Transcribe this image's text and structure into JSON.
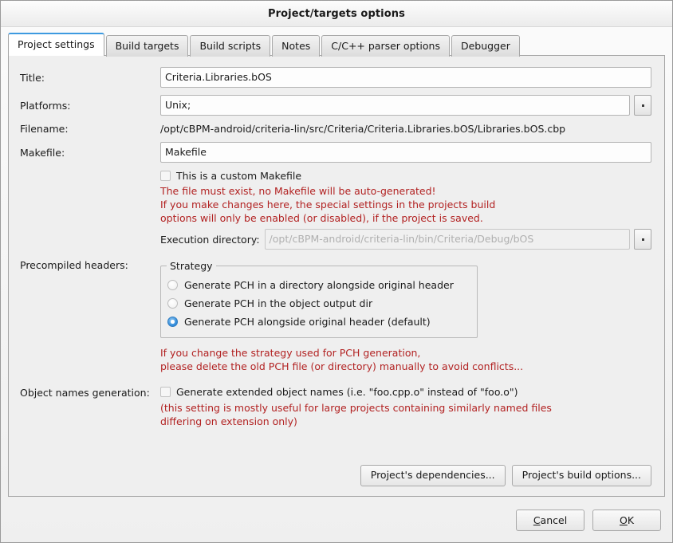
{
  "window": {
    "title": "Project/targets options"
  },
  "tabs": [
    {
      "label": "Project settings",
      "active": true
    },
    {
      "label": "Build targets",
      "active": false
    },
    {
      "label": "Build scripts",
      "active": false
    },
    {
      "label": "Notes",
      "active": false
    },
    {
      "label": "C/C++ parser options",
      "active": false
    },
    {
      "label": "Debugger",
      "active": false
    }
  ],
  "form": {
    "title_label": "Title:",
    "title_value": "Criteria.Libraries.bOS",
    "platforms_label": "Platforms:",
    "platforms_value": "Unix;",
    "platforms_browse": "browse-button",
    "filename_label": "Filename:",
    "filename_value": "/opt/cBPM-android/criteria-lin/src/Criteria/Criteria.Libraries.bOS/Libraries.bOS.cbp",
    "makefile_label": "Makefile:",
    "makefile_value": "Makefile",
    "custom_makefile_label": "This is a custom Makefile",
    "custom_makefile_checked": false,
    "warning_line1": "The file must exist, no Makefile will be auto-generated!",
    "warning_line2": "If you make changes here, the special settings in the projects build",
    "warning_line3": "options will only be enabled (or disabled), if the project is saved.",
    "exec_dir_label": "Execution directory:",
    "exec_dir_value": "/opt/cBPM-android/criteria-lin/bin/Criteria/Debug/bOS",
    "exec_dir_disabled": true,
    "precompiled_headers_label": "Precompiled headers:",
    "strategy_group_title": "Strategy",
    "strategy_options": [
      {
        "label": "Generate PCH in a directory alongside original header",
        "selected": false
      },
      {
        "label": "Generate PCH in the object output dir",
        "selected": false
      },
      {
        "label": "Generate PCH alongside original header (default)",
        "selected": true
      }
    ],
    "pch_warning_line1": "If you change the strategy used for PCH generation,",
    "pch_warning_line2": "please delete the old PCH file (or directory) manually to avoid conflicts...",
    "object_names_label": "Object names generation:",
    "object_names_checkbox_label": "Generate extended object names (i.e. \"foo.cpp.o\" instead of \"foo.o\")",
    "object_names_checked": false,
    "object_names_note_line1": "(this setting is mostly useful for large projects containing similarly named files",
    "object_names_note_line2": "differing on extension only)"
  },
  "panel_actions": {
    "dependencies_label": "Project's dependencies...",
    "build_options_label": "Project's build options..."
  },
  "footer": {
    "cancel_mnemonic": "C",
    "cancel_rest": "ancel",
    "ok_mnemonic": "O",
    "ok_rest": "K"
  },
  "colors": {
    "warning_red": "#b22222",
    "accent_blue": "#3d9ae0",
    "radio_selected": "#2f8ada",
    "panel_bg": "#efefef",
    "field_bg": "#fdfdfd",
    "disabled_text": "#b0b0b0"
  }
}
